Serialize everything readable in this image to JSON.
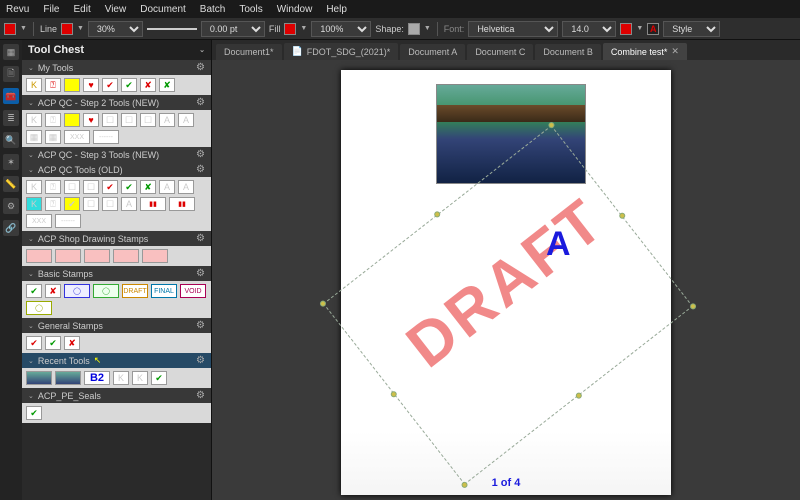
{
  "menu": [
    "Revu",
    "File",
    "Edit",
    "View",
    "Document",
    "Batch",
    "Tools",
    "Window",
    "Help"
  ],
  "toolbar": {
    "line_label": "Line",
    "opacity": "30%",
    "width_label": "0.00 pt",
    "fill_label": "Fill",
    "fill_pct": "100%",
    "shape_label": "Shape:",
    "font_label": "Font:",
    "font_name": "Helvetica",
    "font_size": "14.0",
    "style_label": "Style"
  },
  "side_title": "Tool Chest",
  "sections": [
    {
      "name": "My Tools"
    },
    {
      "name": "ACP QC - Step 2 Tools (NEW)"
    },
    {
      "name": "ACP QC - Step 3 Tools (NEW)"
    },
    {
      "name": "ACP QC Tools (OLD)"
    },
    {
      "name": "ACP Shop Drawing Stamps"
    },
    {
      "name": "Basic Stamps"
    },
    {
      "name": "General Stamps"
    },
    {
      "name": "Recent Tools"
    },
    {
      "name": "ACP_PE_Seals"
    }
  ],
  "stamp_labels": {
    "xxx": "XXX",
    "dashes": "------",
    "draft": "DRAFT",
    "final": "FINAL",
    "void": "VOID",
    "b2": "B2"
  },
  "tabs": [
    {
      "label": "Document1*",
      "active": false
    },
    {
      "label": "FDOT_SDG_(2021)*",
      "active": false,
      "icon": true
    },
    {
      "label": "Document A",
      "active": false
    },
    {
      "label": "Document C",
      "active": false
    },
    {
      "label": "Document B",
      "active": false
    },
    {
      "label": "Combine test*",
      "active": true,
      "close": true
    }
  ],
  "page": {
    "watermark": "DRAFT",
    "letter": "A",
    "counter": "1 of 4"
  },
  "colors": {
    "accent": "#0b5ea8"
  }
}
